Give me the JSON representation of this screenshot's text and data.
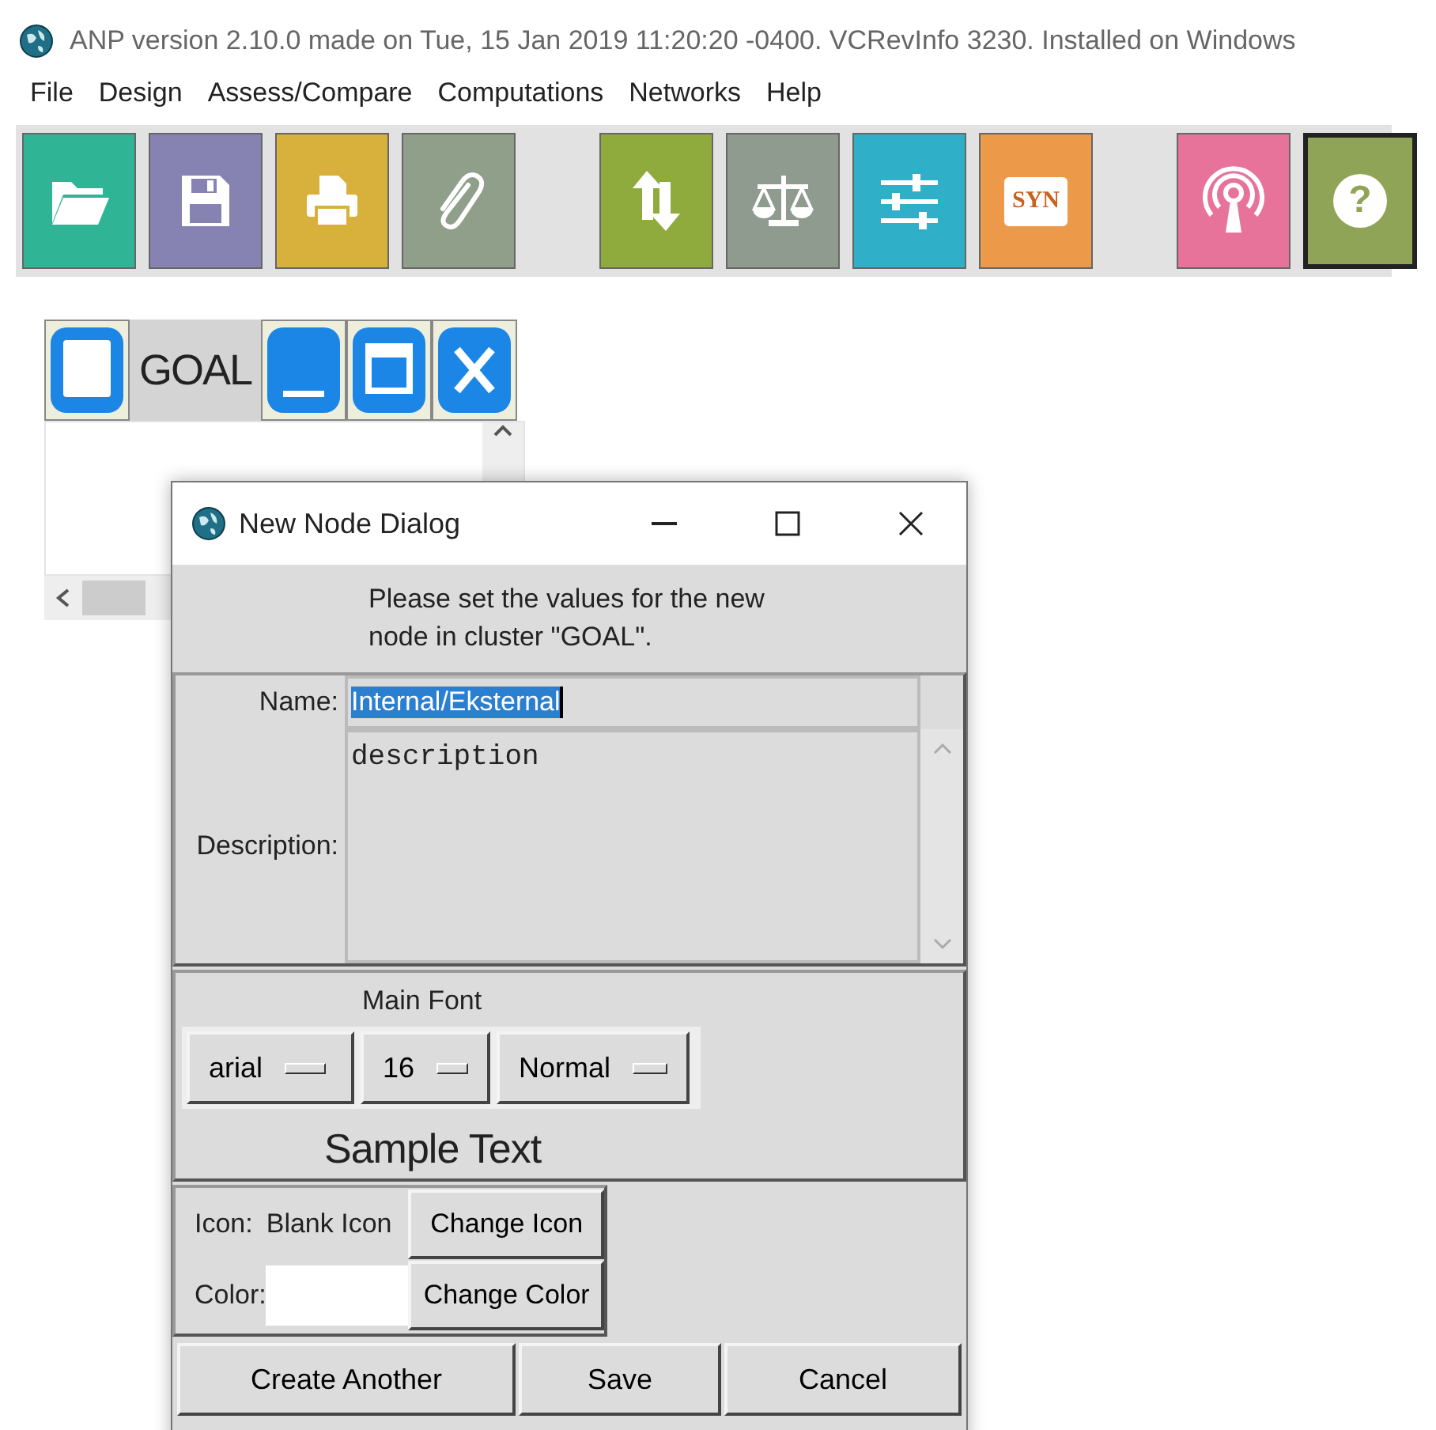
{
  "window": {
    "title": "ANP version 2.10.0 made on Tue, 15 Jan 2019 11:20:20 -0400.  VCRevInfo 3230.  Installed on Windows"
  },
  "menu": [
    "File",
    "Design",
    "Assess/Compare",
    "Computations",
    "Networks",
    "Help"
  ],
  "toolbar": [
    [
      {
        "kind": "folder",
        "color": "#2fb596",
        "selected": false
      },
      {
        "kind": "floppy",
        "color": "#8682b2",
        "selected": false
      },
      {
        "kind": "printer",
        "color": "#d8b13c",
        "selected": false
      },
      {
        "kind": "paperclip",
        "color": "#8f9f8a",
        "selected": false
      }
    ],
    [
      {
        "kind": "arrows",
        "color": "#8fab3e",
        "selected": false
      },
      {
        "kind": "scales",
        "color": "#8e9b8e",
        "selected": false
      },
      {
        "kind": "sliders",
        "color": "#2fb0c8",
        "selected": false
      },
      {
        "kind": "badge",
        "label": "SYN",
        "color": "#ec9a4a",
        "selected": false
      }
    ],
    [
      {
        "kind": "antenna",
        "color": "#e8739a",
        "selected": false
      },
      {
        "kind": "help",
        "label": "?",
        "color": "#8fa456",
        "selected": true
      }
    ]
  ],
  "cluster": {
    "title": "GOAL"
  },
  "dialog": {
    "title": "New Node Dialog",
    "message": "Please set the values for the new node in cluster \"GOAL\".",
    "name": {
      "label": "Name:",
      "value": "Internal/Eksternal",
      "text_selected": true
    },
    "description": {
      "label": "Description:",
      "value": "description"
    },
    "font": {
      "title": "Main Font",
      "family": "arial",
      "size": "16",
      "style": "Normal",
      "sample": "Sample Text"
    },
    "icon": {
      "label": "Icon:",
      "value": "Blank Icon",
      "button": "Change Icon"
    },
    "color": {
      "label": "Color:",
      "button": "Change Color"
    },
    "buttons": [
      "Create Another",
      "Save",
      "Cancel"
    ]
  }
}
